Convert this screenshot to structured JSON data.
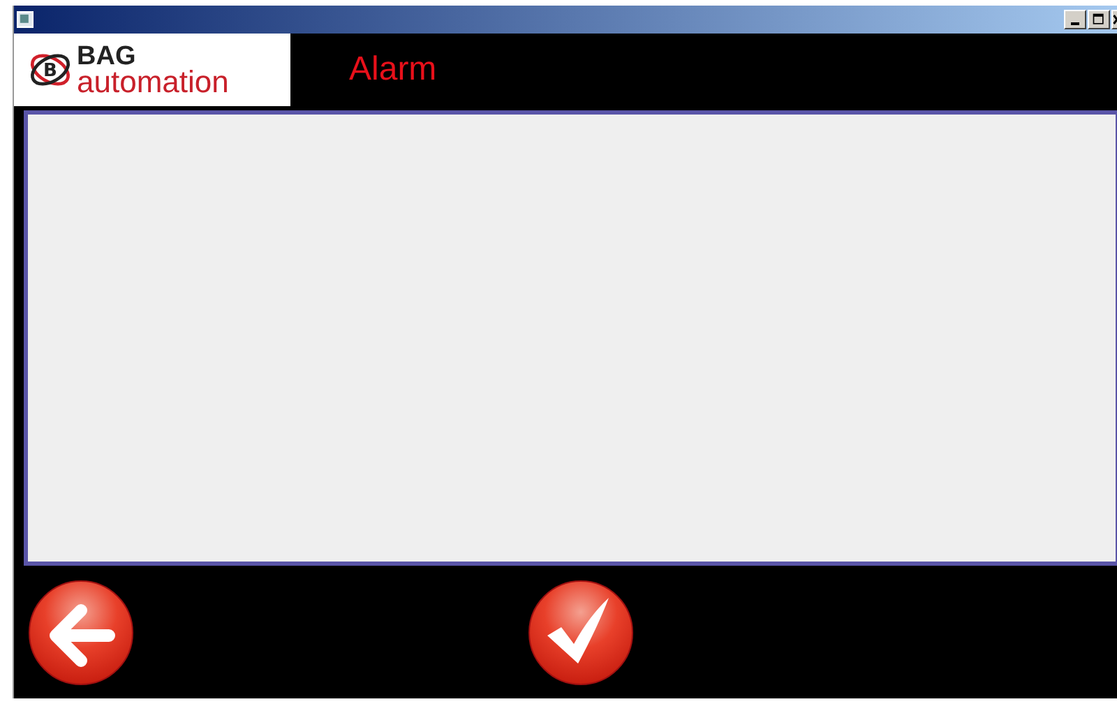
{
  "logo": {
    "mark": "B",
    "brand": "BAG",
    "tagline": "automation"
  },
  "screen": {
    "title": "Alarm"
  },
  "buttons": [
    {
      "kind": "back"
    },
    {
      "kind": "confirm"
    }
  ]
}
